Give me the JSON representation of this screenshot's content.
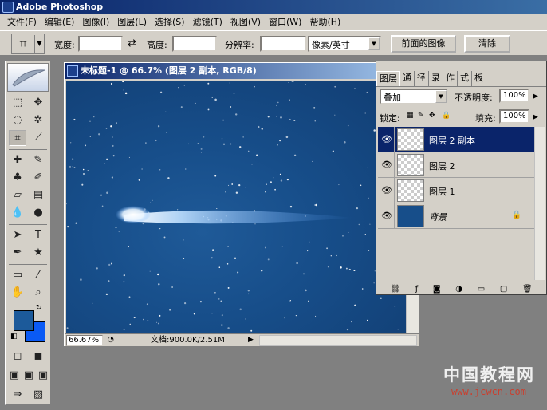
{
  "app": {
    "title": "Adobe Photoshop"
  },
  "menu": [
    "文件(F)",
    "编辑(E)",
    "图像(I)",
    "图层(L)",
    "选择(S)",
    "滤镜(T)",
    "视图(V)",
    "窗口(W)",
    "帮助(H)"
  ],
  "options": {
    "width_label": "宽度:",
    "width_value": "",
    "height_label": "高度:",
    "height_value": "",
    "resolution_label": "分辨率:",
    "resolution_value": "",
    "unit": "像素/英寸",
    "front_image_button": "前面的图像",
    "clear_button": "清除"
  },
  "document": {
    "title": "未标题-1 @ 66.7% (图层 2 副本, RGB/8)",
    "zoom": "66.67%",
    "doc_info": "文档:900.0K/2.51M",
    "colors": {
      "bg_top": "#113d72",
      "bg_mid": "#1f5a98"
    }
  },
  "toolbox": {
    "foreground_color": "#1c5a9a",
    "background_color": "#0a5af5"
  },
  "layers_palette": {
    "tabs": [
      "图层",
      "通",
      "径",
      "录",
      "作",
      "式",
      "板"
    ],
    "blend_mode": "叠加",
    "opacity_label": "不透明度:",
    "opacity_value": "100%",
    "lock_label": "锁定:",
    "fill_label": "填充:",
    "fill_value": "100%",
    "layers": [
      {
        "name": "图层 2 副本",
        "selected": true
      },
      {
        "name": "图层 2",
        "selected": false
      },
      {
        "name": "图层 1",
        "selected": false
      },
      {
        "name": "背景",
        "selected": false,
        "locked": true
      }
    ]
  },
  "watermark": {
    "big": "中国教程网",
    "small": "www.jcwcn.com"
  }
}
